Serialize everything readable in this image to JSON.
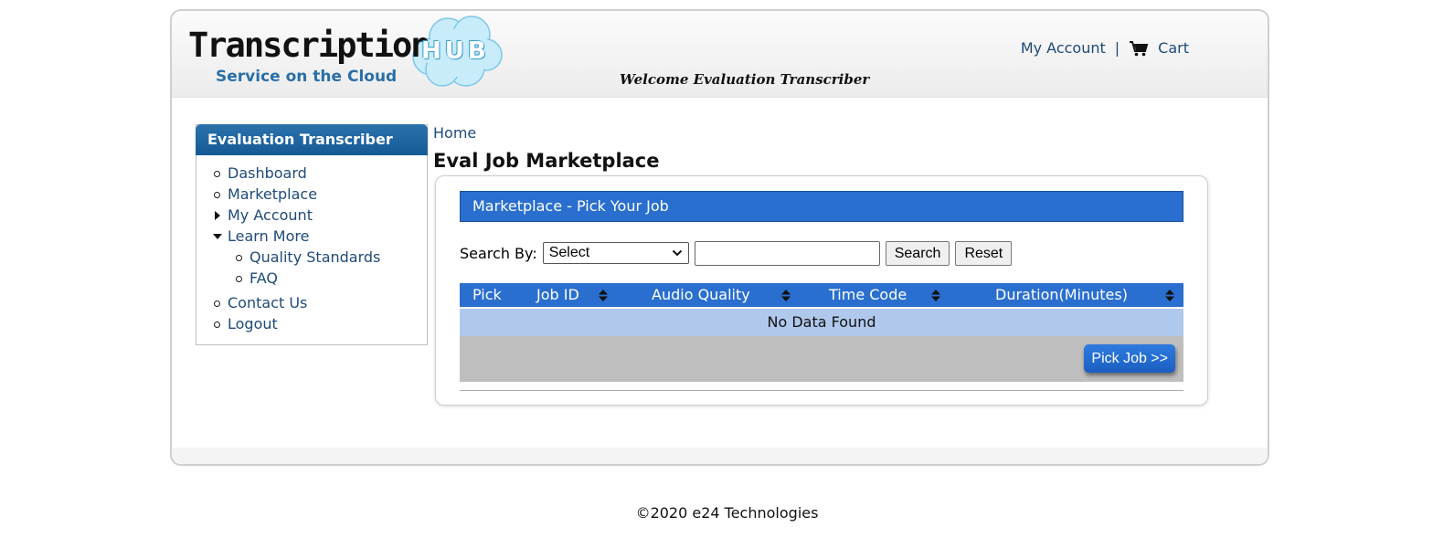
{
  "header": {
    "logo_word": "Transcription",
    "logo_badge": "HUB",
    "logo_tagline": "Service on the Cloud",
    "welcome": "Welcome Evaluation Transcriber",
    "my_account": "My Account",
    "separator": "|",
    "cart": "Cart"
  },
  "sidebar": {
    "title": "Evaluation Transcriber",
    "items": [
      {
        "label": "Dashboard"
      },
      {
        "label": "Marketplace"
      },
      {
        "label": "My Account"
      },
      {
        "label": "Learn More"
      },
      {
        "label": "Contact Us"
      },
      {
        "label": "Logout"
      }
    ],
    "learn_more_sub": [
      {
        "label": "Quality Standards"
      },
      {
        "label": "FAQ"
      }
    ]
  },
  "main": {
    "breadcrumb": "Home",
    "title": "Eval Job Marketplace",
    "panel_title": "Marketplace - Pick Your Job",
    "search": {
      "label": "Search By:",
      "select_value": "Select",
      "input_value": "",
      "search_btn": "Search",
      "reset_btn": "Reset"
    },
    "table": {
      "columns": [
        "Pick",
        "Job ID",
        "Audio Quality",
        "Time Code",
        "Duration(Minutes)"
      ],
      "empty_text": "No Data Found"
    },
    "pick_job_btn": "Pick Job >>"
  },
  "footer": {
    "copyright": "©2020 e24 Technologies"
  },
  "colors": {
    "brand_blue": "#2a6fcf",
    "link": "#1f4a78",
    "sidebar_head": "#155a95",
    "empty_row": "#b0c8eb"
  }
}
